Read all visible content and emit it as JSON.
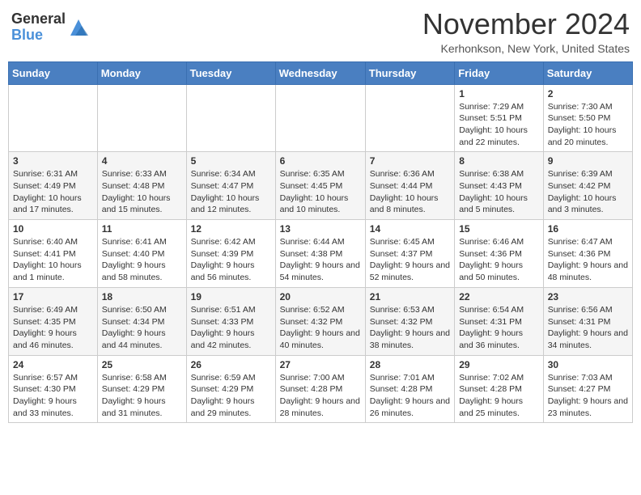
{
  "header": {
    "logo_general": "General",
    "logo_blue": "Blue",
    "month_title": "November 2024",
    "location": "Kerhonkson, New York, United States"
  },
  "days_of_week": [
    "Sunday",
    "Monday",
    "Tuesday",
    "Wednesday",
    "Thursday",
    "Friday",
    "Saturday"
  ],
  "weeks": [
    [
      {
        "day": "",
        "info": ""
      },
      {
        "day": "",
        "info": ""
      },
      {
        "day": "",
        "info": ""
      },
      {
        "day": "",
        "info": ""
      },
      {
        "day": "",
        "info": ""
      },
      {
        "day": "1",
        "info": "Sunrise: 7:29 AM\nSunset: 5:51 PM\nDaylight: 10 hours and 22 minutes."
      },
      {
        "day": "2",
        "info": "Sunrise: 7:30 AM\nSunset: 5:50 PM\nDaylight: 10 hours and 20 minutes."
      }
    ],
    [
      {
        "day": "3",
        "info": "Sunrise: 6:31 AM\nSunset: 4:49 PM\nDaylight: 10 hours and 17 minutes."
      },
      {
        "day": "4",
        "info": "Sunrise: 6:33 AM\nSunset: 4:48 PM\nDaylight: 10 hours and 15 minutes."
      },
      {
        "day": "5",
        "info": "Sunrise: 6:34 AM\nSunset: 4:47 PM\nDaylight: 10 hours and 12 minutes."
      },
      {
        "day": "6",
        "info": "Sunrise: 6:35 AM\nSunset: 4:45 PM\nDaylight: 10 hours and 10 minutes."
      },
      {
        "day": "7",
        "info": "Sunrise: 6:36 AM\nSunset: 4:44 PM\nDaylight: 10 hours and 8 minutes."
      },
      {
        "day": "8",
        "info": "Sunrise: 6:38 AM\nSunset: 4:43 PM\nDaylight: 10 hours and 5 minutes."
      },
      {
        "day": "9",
        "info": "Sunrise: 6:39 AM\nSunset: 4:42 PM\nDaylight: 10 hours and 3 minutes."
      }
    ],
    [
      {
        "day": "10",
        "info": "Sunrise: 6:40 AM\nSunset: 4:41 PM\nDaylight: 10 hours and 1 minute."
      },
      {
        "day": "11",
        "info": "Sunrise: 6:41 AM\nSunset: 4:40 PM\nDaylight: 9 hours and 58 minutes."
      },
      {
        "day": "12",
        "info": "Sunrise: 6:42 AM\nSunset: 4:39 PM\nDaylight: 9 hours and 56 minutes."
      },
      {
        "day": "13",
        "info": "Sunrise: 6:44 AM\nSunset: 4:38 PM\nDaylight: 9 hours and 54 minutes."
      },
      {
        "day": "14",
        "info": "Sunrise: 6:45 AM\nSunset: 4:37 PM\nDaylight: 9 hours and 52 minutes."
      },
      {
        "day": "15",
        "info": "Sunrise: 6:46 AM\nSunset: 4:36 PM\nDaylight: 9 hours and 50 minutes."
      },
      {
        "day": "16",
        "info": "Sunrise: 6:47 AM\nSunset: 4:36 PM\nDaylight: 9 hours and 48 minutes."
      }
    ],
    [
      {
        "day": "17",
        "info": "Sunrise: 6:49 AM\nSunset: 4:35 PM\nDaylight: 9 hours and 46 minutes."
      },
      {
        "day": "18",
        "info": "Sunrise: 6:50 AM\nSunset: 4:34 PM\nDaylight: 9 hours and 44 minutes."
      },
      {
        "day": "19",
        "info": "Sunrise: 6:51 AM\nSunset: 4:33 PM\nDaylight: 9 hours and 42 minutes."
      },
      {
        "day": "20",
        "info": "Sunrise: 6:52 AM\nSunset: 4:32 PM\nDaylight: 9 hours and 40 minutes."
      },
      {
        "day": "21",
        "info": "Sunrise: 6:53 AM\nSunset: 4:32 PM\nDaylight: 9 hours and 38 minutes."
      },
      {
        "day": "22",
        "info": "Sunrise: 6:54 AM\nSunset: 4:31 PM\nDaylight: 9 hours and 36 minutes."
      },
      {
        "day": "23",
        "info": "Sunrise: 6:56 AM\nSunset: 4:31 PM\nDaylight: 9 hours and 34 minutes."
      }
    ],
    [
      {
        "day": "24",
        "info": "Sunrise: 6:57 AM\nSunset: 4:30 PM\nDaylight: 9 hours and 33 minutes."
      },
      {
        "day": "25",
        "info": "Sunrise: 6:58 AM\nSunset: 4:29 PM\nDaylight: 9 hours and 31 minutes."
      },
      {
        "day": "26",
        "info": "Sunrise: 6:59 AM\nSunset: 4:29 PM\nDaylight: 9 hours and 29 minutes."
      },
      {
        "day": "27",
        "info": "Sunrise: 7:00 AM\nSunset: 4:28 PM\nDaylight: 9 hours and 28 minutes."
      },
      {
        "day": "28",
        "info": "Sunrise: 7:01 AM\nSunset: 4:28 PM\nDaylight: 9 hours and 26 minutes."
      },
      {
        "day": "29",
        "info": "Sunrise: 7:02 AM\nSunset: 4:28 PM\nDaylight: 9 hours and 25 minutes."
      },
      {
        "day": "30",
        "info": "Sunrise: 7:03 AM\nSunset: 4:27 PM\nDaylight: 9 hours and 23 minutes."
      }
    ]
  ]
}
